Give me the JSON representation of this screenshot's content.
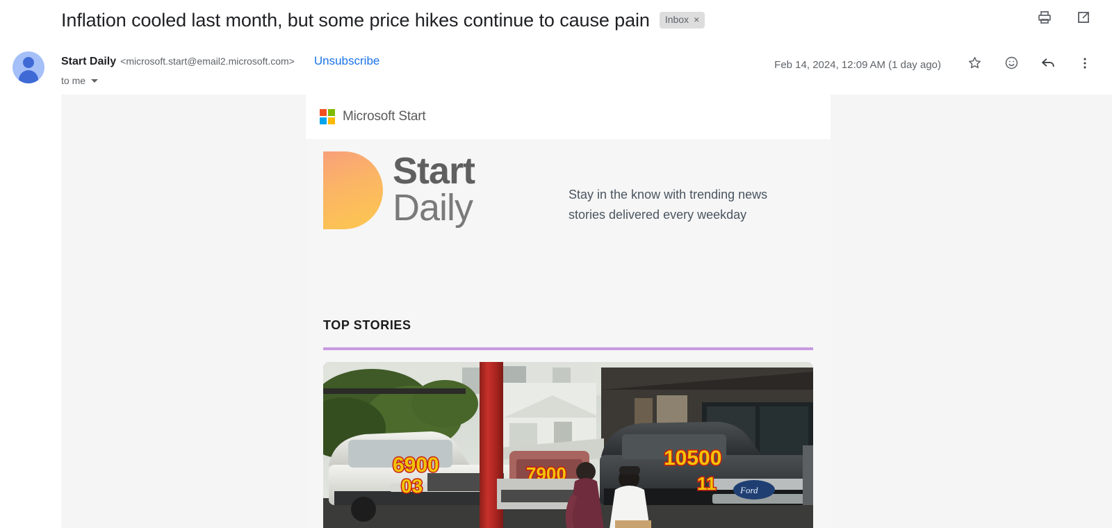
{
  "email": {
    "subject": "Inflation cooled last month, but some price hikes continue to cause pain",
    "label_chip": "Inbox",
    "label_chip_close": "×",
    "sender_name": "Start Daily",
    "sender_email": "<microsoft.start@email2.microsoft.com>",
    "unsubscribe_label": "Unsubscribe",
    "recipient_line": "to me",
    "timestamp": "Feb 14, 2024, 12:09 AM (1 day ago)"
  },
  "subject_actions": {
    "print": "print-icon",
    "open_new_window": "open-in-new-window-icon"
  },
  "message_actions": {
    "star": "star-icon",
    "react": "add-reaction-icon",
    "reply": "reply-icon",
    "more": "more-options-icon"
  },
  "newsletter": {
    "brand_bar_title": "Microsoft Start",
    "logo_word_start": "Start",
    "logo_word_daily": "Daily",
    "tagline": "Stay in the know with trending news stories delivered every weekday",
    "section_heading": "TOP STORIES",
    "photo_alt": "Used pickup trucks at a car lot with handwritten windshield price stickers",
    "photo_price_tags": [
      "6900",
      "03",
      "7900",
      "10500",
      "11"
    ],
    "truck_badge": "Ford"
  },
  "colors": {
    "link_blue": "#1a73e8",
    "divider_purple": "#c59ae0",
    "body_background": "#f5f5f5",
    "ms_red": "#f25022",
    "ms_green": "#7fba00",
    "ms_blue": "#00a4ef",
    "ms_yellow": "#ffb900",
    "brand_gradient_start": "#f8a07a",
    "brand_gradient_end": "#fdc84e"
  }
}
